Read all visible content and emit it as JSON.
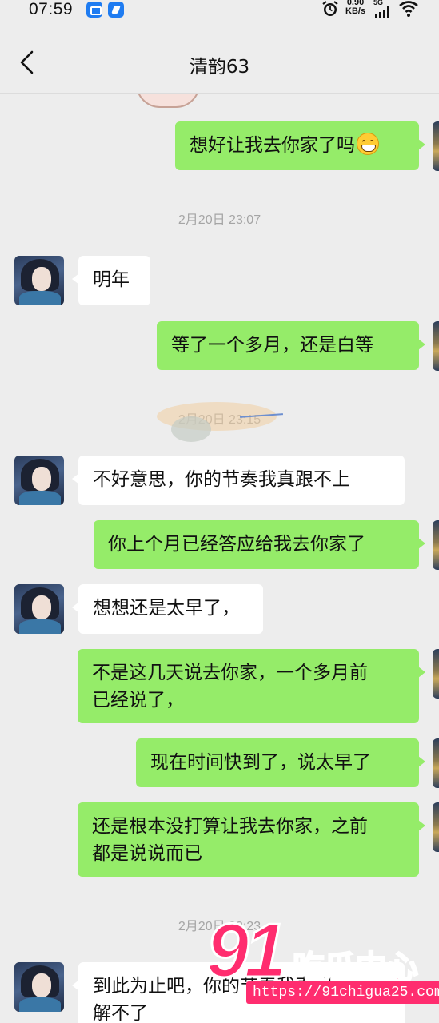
{
  "status_bar": {
    "time": "07:59",
    "net_speed_value": "0.90",
    "net_speed_unit": "KB/s",
    "network_type": "5G",
    "icons": [
      "notification-app-icon",
      "notification-app-icon-2",
      "alarm-icon",
      "cellular-signal-icon",
      "wifi-icon"
    ]
  },
  "header": {
    "title": "清韵63",
    "back_icon": "chevron-left-icon"
  },
  "messages": [
    {
      "side": "out",
      "text": "想好让我去你家了吗",
      "emoji": "grinning-face-emoji"
    },
    {
      "type": "timestamp",
      "text": "2月20日 23:07"
    },
    {
      "side": "in",
      "text": "明年"
    },
    {
      "side": "out",
      "text": "等了一个多月，还是白等"
    },
    {
      "type": "timestamp",
      "text": "2月20日 23:15"
    },
    {
      "side": "in",
      "text": "不好意思，你的节奏我真跟不上"
    },
    {
      "side": "out",
      "text": "你上个月已经答应给我去你家了"
    },
    {
      "side": "in",
      "text": "想想还是太早了，"
    },
    {
      "side": "out",
      "line1": "不是这几天说去你家，一个多月前",
      "line2": "已经说了，"
    },
    {
      "side": "out",
      "text": "现在时间快到了，说太早了"
    },
    {
      "side": "out",
      "line1": "还是根本没打算让我去你家，之前",
      "line2": "都是说说而已"
    },
    {
      "type": "timestamp",
      "text": "2月20日 23:23"
    },
    {
      "side": "in",
      "line1": "到此为止吧，你的节奏我真理",
      "line2": "解不了"
    }
  ],
  "watermark": {
    "number": "91",
    "name": "吃瓜中心",
    "url": "https://91chigua25.com"
  },
  "colors": {
    "background": "#ededed",
    "outgoing_bubble": "#95ec69",
    "incoming_bubble": "#ffffff",
    "timestamp_text": "#a5a5a5",
    "watermark": "#ff2d6f"
  }
}
